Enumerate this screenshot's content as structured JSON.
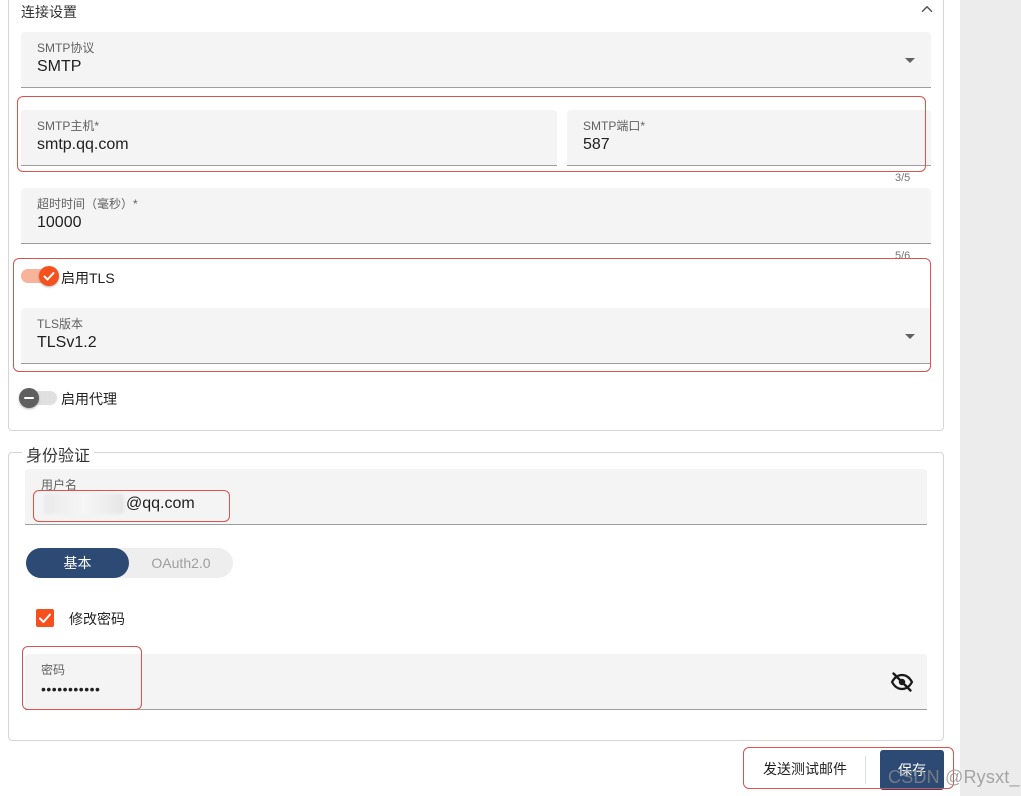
{
  "connection": {
    "title": "连接设置",
    "smtp_protocol": {
      "label": "SMTP协议",
      "value": "SMTP"
    },
    "smtp_host": {
      "label": "SMTP主机*",
      "value": "smtp.qq.com"
    },
    "smtp_port": {
      "label": "SMTP端口*",
      "value": "587",
      "counter": "3/5"
    },
    "timeout": {
      "label": "超时时间（毫秒）*",
      "value": "10000",
      "counter": "5/6"
    },
    "tls_switch": {
      "label": "启用TLS",
      "on": true
    },
    "tls_version": {
      "label": "TLS版本",
      "value": "TLSv1.2"
    },
    "proxy_switch": {
      "label": "启用代理",
      "on": false
    }
  },
  "auth": {
    "title": "身份验证",
    "username": {
      "label": "用户名",
      "value_suffix": "@qq.com"
    },
    "mode_options": [
      "基本",
      "OAuth2.0"
    ],
    "selected_mode": "基本",
    "change_password": {
      "label": "修改密码",
      "checked": true
    },
    "password": {
      "label": "密码",
      "value": "•••••••••••"
    }
  },
  "actions": {
    "send_test": "发送测试邮件",
    "save": "保存"
  },
  "watermark": "CSDN @Rysxt_",
  "colors": {
    "accent": "#f4511e",
    "primary": "#2c4a73",
    "highlight": "#d9534f",
    "field_bg": "#f4f4f4"
  },
  "icons": {
    "collapse": "chevron-up-icon",
    "dropdown": "caret-down-icon",
    "checkmark": "check-icon",
    "visibility": "eye-off-icon",
    "proxy_knob": "minus-icon"
  }
}
